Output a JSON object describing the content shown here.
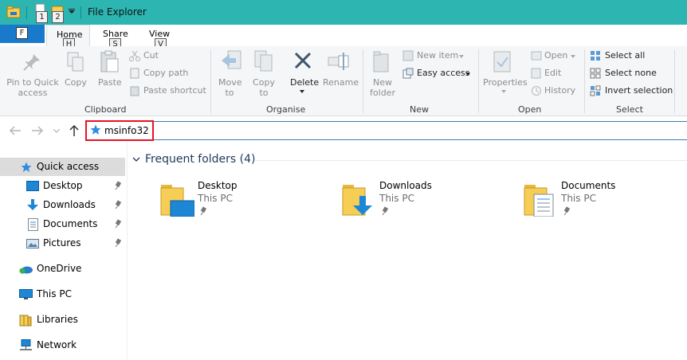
{
  "window": {
    "title": "File Explorer",
    "keytips": {
      "qat1": "1",
      "qat2": "2",
      "home": "H",
      "share": "S",
      "view": "V"
    }
  },
  "tabs": {
    "file": "F",
    "home": "Home",
    "share": "Share",
    "view": "View"
  },
  "ribbon": {
    "clipboard": {
      "pin_label_1": "Pin to Quick",
      "pin_label_2": "access",
      "copy": "Copy",
      "paste": "Paste",
      "cut": "Cut",
      "copy_path": "Copy path",
      "paste_shortcut": "Paste shortcut",
      "group": "Clipboard"
    },
    "organise": {
      "move_to_1": "Move",
      "move_to_2": "to",
      "copy_to_1": "Copy",
      "copy_to_2": "to",
      "delete": "Delete",
      "rename": "Rename",
      "group": "Organise"
    },
    "new": {
      "new_folder_1": "New",
      "new_folder_2": "folder",
      "new_item": "New item",
      "easy_access": "Easy access",
      "group": "New"
    },
    "open": {
      "properties": "Properties",
      "open": "Open",
      "edit": "Edit",
      "history": "History",
      "group": "Open"
    },
    "select": {
      "select_all": "Select all",
      "select_none": "Select none",
      "invert_selection": "Invert selection",
      "group": "Select"
    }
  },
  "address_bar": {
    "value": "msinfo32"
  },
  "sidebar": {
    "quick_access": "Quick access",
    "items": [
      {
        "label": "Desktop"
      },
      {
        "label": "Downloads"
      },
      {
        "label": "Documents"
      },
      {
        "label": "Pictures"
      }
    ],
    "onedrive": "OneDrive",
    "this_pc": "This PC",
    "libraries": "Libraries",
    "network": "Network"
  },
  "content": {
    "section_title": "Frequent folders (4)",
    "folders": [
      {
        "name": "Desktop",
        "location": "This PC"
      },
      {
        "name": "Downloads",
        "location": "This PC"
      },
      {
        "name": "Documents",
        "location": "This PC"
      }
    ]
  },
  "colors": {
    "titlebar": "#2cb5b1",
    "file_tab": "#1979ca",
    "accent_link": "#1e395b",
    "highlight_box": "#e81123",
    "selected_nav": "#dcdcdc"
  }
}
